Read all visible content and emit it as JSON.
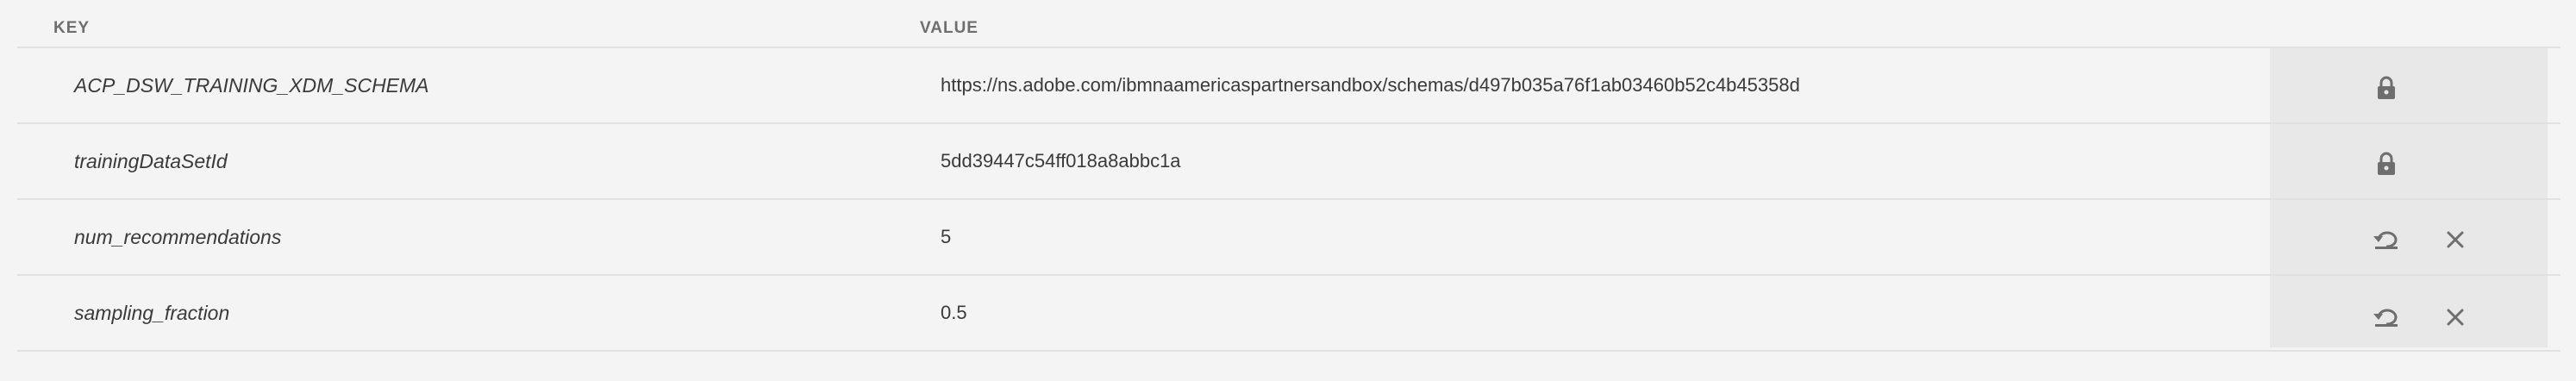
{
  "table": {
    "columns": {
      "key": "KEY",
      "value": "VALUE"
    },
    "rows": [
      {
        "key": "ACP_DSW_TRAINING_XDM_SCHEMA",
        "value": "https://ns.adobe.com/ibmnaamericaspartnersandbox/schemas/d497b035a76f1ab03460b52c4b45358d",
        "actions": [
          "lock-icon"
        ]
      },
      {
        "key": "trainingDataSetId",
        "value": "5dd39447c54ff018a8abbc1a",
        "actions": [
          "lock-icon"
        ]
      },
      {
        "key": "num_recommendations",
        "value": "5",
        "actions": [
          "reset-icon",
          "close-icon"
        ]
      },
      {
        "key": "sampling_fraction",
        "value": "0.5",
        "actions": [
          "reset-icon",
          "close-icon"
        ]
      }
    ]
  },
  "colors": {
    "background": "#f4f4f4",
    "action_column": "#e8e8e8",
    "divider": "#e1e1e1",
    "icon": "#6e6e6e"
  }
}
